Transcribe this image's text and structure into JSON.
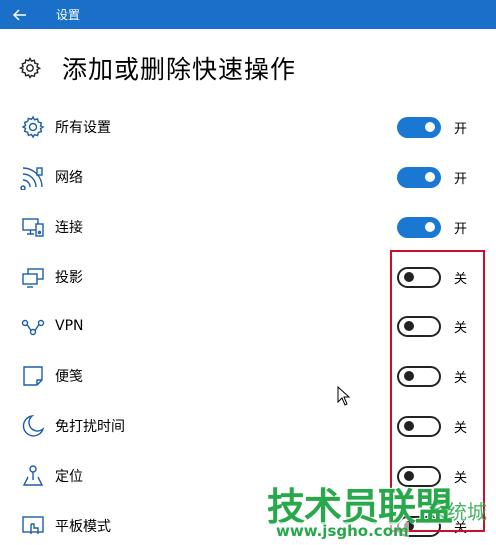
{
  "titlebar": {
    "title": "设置"
  },
  "page": {
    "title": "添加或删除快速操作"
  },
  "items": [
    {
      "icon": "gear-icon",
      "label": "所有设置",
      "on": true,
      "state": "开"
    },
    {
      "icon": "network-icon",
      "label": "网络",
      "on": true,
      "state": "开"
    },
    {
      "icon": "connect-icon",
      "label": "连接",
      "on": true,
      "state": "开"
    },
    {
      "icon": "project-icon",
      "label": "投影",
      "on": false,
      "state": "关"
    },
    {
      "icon": "vpn-icon",
      "label": "VPN",
      "on": false,
      "state": "关"
    },
    {
      "icon": "note-icon",
      "label": "便笺",
      "on": false,
      "state": "关"
    },
    {
      "icon": "moon-icon",
      "label": "免打扰时间",
      "on": false,
      "state": "关"
    },
    {
      "icon": "location-icon",
      "label": "定位",
      "on": false,
      "state": "关"
    },
    {
      "icon": "tablet-mode-icon",
      "label": "平板模式",
      "on": false,
      "state": "关"
    }
  ],
  "colors": {
    "accent": "#1a78d2",
    "titlebar": "#1a6fc9",
    "highlight": "#c8102e",
    "watermark": "#27a84a"
  },
  "watermark": {
    "brand": "技术员联盟",
    "side": "系统城",
    "url": "www.jsgho.com"
  }
}
